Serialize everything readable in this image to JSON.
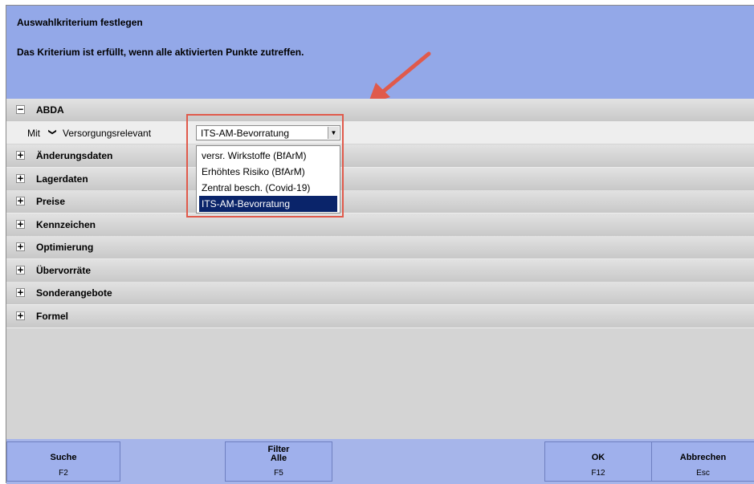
{
  "header": {
    "title": "Auswahlkriterium festlegen",
    "subtitle": "Das Kriterium ist erfüllt, wenn alle aktivierten Punkte zutreffen."
  },
  "sections": [
    {
      "label": "ABDA",
      "toggle": "−",
      "expanded": true
    },
    {
      "label": "Änderungsdaten",
      "toggle": "+"
    },
    {
      "label": "Lagerdaten",
      "toggle": "+"
    },
    {
      "label": "Preise",
      "toggle": "+"
    },
    {
      "label": "Kennzeichen",
      "toggle": "+"
    },
    {
      "label": "Optimierung",
      "toggle": "+"
    },
    {
      "label": "Übervorräte",
      "toggle": "+"
    },
    {
      "label": "Sonderangebote",
      "toggle": "+"
    },
    {
      "label": "Formel",
      "toggle": "+"
    }
  ],
  "abda_row": {
    "mit_label": "Mit",
    "mit_chevron": "❯",
    "field_label": "Versorgungsrelevant",
    "select_value": "ITS-AM-Bevorratung",
    "select_button": "▼"
  },
  "dropdown": {
    "options": [
      "versr. Wirkstoffe (BfArM)",
      "Erhöhtes Risiko (BfArM)",
      "Zentral besch. (Covid-19)",
      "ITS-AM-Bevorratung"
    ],
    "selected_index": 3
  },
  "footer": {
    "buttons": [
      {
        "label": "Suche",
        "key": "F2"
      },
      {
        "label": "Filter",
        "label2": "Alle",
        "key": "F5"
      },
      {
        "label": "OK",
        "key": "F12"
      },
      {
        "label": "Abbrechen",
        "key": "Esc"
      }
    ]
  },
  "colors": {
    "header_bg": "#93a8e8",
    "footer_bg": "#a6b5ea",
    "selection": "#0a246a",
    "annotation_red": "#e05a4b"
  },
  "icons": {
    "annotation_arrow": "red-arrow-icon",
    "dropdown_button": "chevron-down-icon"
  }
}
